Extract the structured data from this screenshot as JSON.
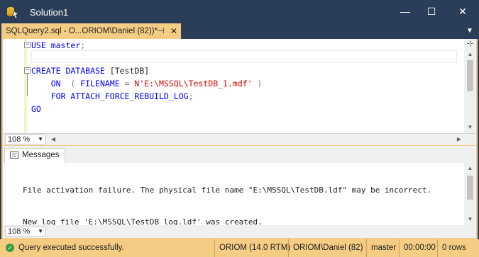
{
  "window": {
    "title": "Solution1",
    "minimize": "—",
    "maximize": "☐",
    "close": "✕"
  },
  "tab": {
    "label": "SQLQuery2.sql - O...ORIOM\\Daniel (82))*",
    "pin": "⊣",
    "close": "✕"
  },
  "editor": {
    "lines": [
      [
        {
          "t": "USE ",
          "c": "kw"
        },
        {
          "t": "master",
          "c": "kw"
        },
        {
          "t": ";",
          "c": "gray"
        }
      ],
      [],
      [
        {
          "t": "CREATE ",
          "c": "kw"
        },
        {
          "t": "DATABASE ",
          "c": "kw"
        },
        {
          "t": "[TestDB]",
          "c": ""
        }
      ],
      [
        {
          "t": "    ON  ",
          "c": "kw"
        },
        {
          "t": "( ",
          "c": "gray"
        },
        {
          "t": "FILENAME ",
          "c": "kw"
        },
        {
          "t": "= ",
          "c": "gray"
        },
        {
          "t": "N'E:\\MSSQL\\TestDB_1.mdf' ",
          "c": "str"
        },
        {
          "t": ")",
          "c": "gray"
        }
      ],
      [
        {
          "t": "    FOR ATTACH_FORCE_REBUILD_LOG",
          "c": "kw"
        },
        {
          "t": ";",
          "c": "gray"
        }
      ],
      [
        {
          "t": "GO",
          "c": "kw"
        }
      ]
    ],
    "zoom": "108 %"
  },
  "results": {
    "tab_label": "Messages",
    "messages": [
      "File activation failure. The physical file name \"E:\\MSSQL\\TestDB.ldf\" may be incorrect.",
      "New log file 'E:\\MSSQL\\TestDB_log.ldf' was created."
    ],
    "zoom": "108 %"
  },
  "status": {
    "message": "Query executed successfully.",
    "server": "ORIOM (14.0 RTM)",
    "user": "ORIOM\\Daniel (82)",
    "database": "master",
    "elapsed": "00:00:00",
    "rows": "0 rows"
  },
  "colors": {
    "title_bg": "#2b3e59",
    "accent": "#f5cc84",
    "keyword": "#0000ff",
    "string": "#e00000"
  }
}
